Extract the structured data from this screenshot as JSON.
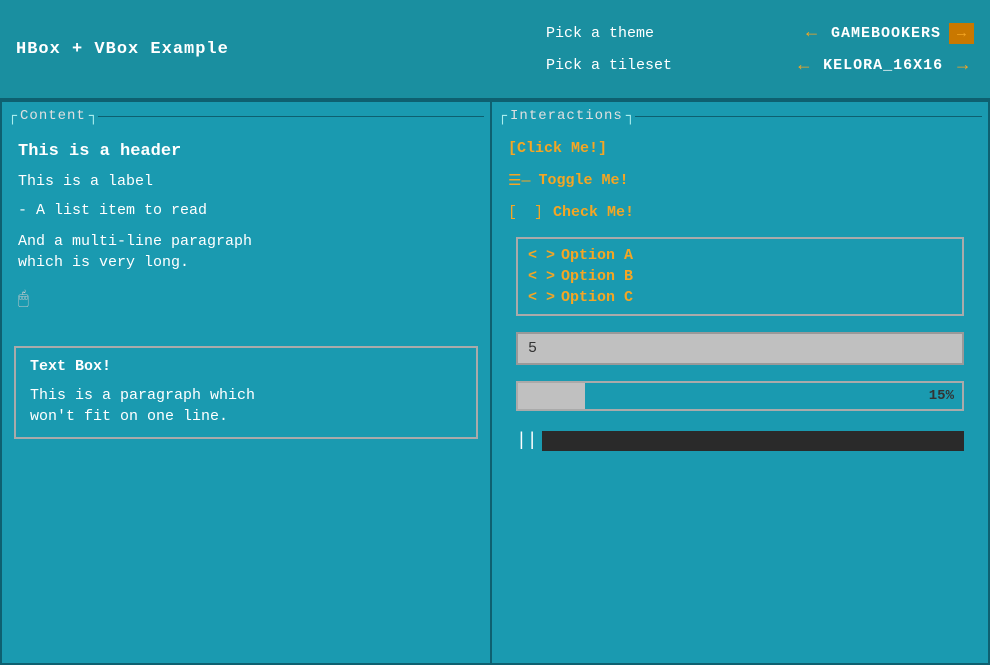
{
  "window": {
    "title": "HBox + VBox Example"
  },
  "top_bar": {
    "title": "HBox + VBox Example",
    "theme_label": "Pick a theme",
    "theme_arrow_left": "←",
    "theme_value": "GAMEBOOKERS",
    "theme_arrow_right": "→",
    "tileset_label": "Pick a tileset",
    "tileset_arrow_left": "←",
    "tileset_value": "KELORA_16X16",
    "tileset_arrow_right": "→"
  },
  "left_panel": {
    "title": "Content",
    "header": "This is a header",
    "label": "This is a label",
    "list_item": "- A list item to read",
    "paragraph_line1": "And a multi-line paragraph",
    "paragraph_line2": "which is very long.",
    "textbox": {
      "title": "Text Box!",
      "body_line1": "This is a paragraph which",
      "body_line2": "won't fit on one line."
    }
  },
  "right_panel": {
    "title": "Interactions",
    "click_btn": "[Click Me!]",
    "toggle_icon": "☰—",
    "toggle_label": "Toggle Me!",
    "checkbox_open": "[",
    "checkbox_space": " ",
    "checkbox_close": "]",
    "checkbox_label": "Check Me!",
    "options": [
      {
        "label": "Option A"
      },
      {
        "label": "Option B"
      },
      {
        "label": "Option C"
      }
    ],
    "number_value": "5",
    "progress_percent": "15%",
    "progress_fill_width": "15%"
  },
  "colors": {
    "bg_teal": "#1a9ab0",
    "accent_orange": "#f5a623",
    "text_white": "#ffffff",
    "border_dark": "#0e6070",
    "input_bg": "#c0c0c0",
    "scrollbar_dark": "#2a2a2a"
  }
}
